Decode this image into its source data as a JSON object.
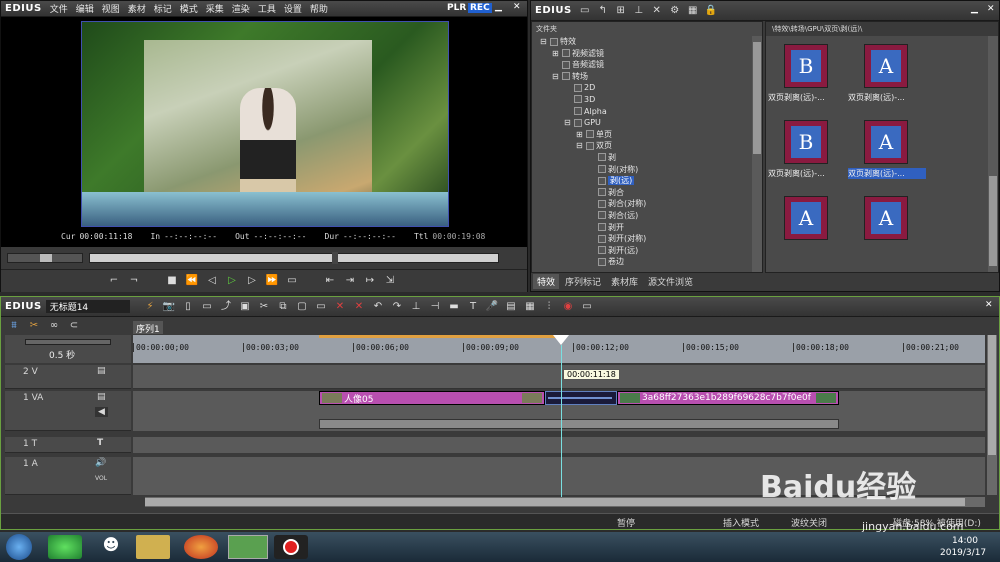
{
  "left_window": {
    "brand": "EDIUS",
    "menu": [
      "文件",
      "编辑",
      "视图",
      "素材",
      "标记",
      "模式",
      "采集",
      "渲染",
      "工具",
      "设置",
      "帮助"
    ],
    "plr": "PLR",
    "rec": "REC"
  },
  "preview": {
    "cur_label": "Cur",
    "cur_value": "00:00:11:18",
    "in_label": "In",
    "in_value": "--:--:--:--",
    "out_label": "Out",
    "out_value": "--:--:--:--",
    "dur_label": "Dur",
    "dur_value": "--:--:--:--",
    "ttl_label": "Ttl",
    "ttl_value": "00:00:19:08"
  },
  "right_window": {
    "brand": "EDIUS",
    "tree_header": "文件夹",
    "path": "\\特效\\转场\\GPU\\双页\\剥(远)\\",
    "tree": [
      {
        "label": "特效",
        "indent": 0,
        "expander": "⊟"
      },
      {
        "label": "视频滤镜",
        "indent": 1,
        "expander": "⊞"
      },
      {
        "label": "音频滤镜",
        "indent": 1,
        "expander": ""
      },
      {
        "label": "转场",
        "indent": 1,
        "expander": "⊟"
      },
      {
        "label": "2D",
        "indent": 2,
        "expander": ""
      },
      {
        "label": "3D",
        "indent": 2,
        "expander": ""
      },
      {
        "label": "Alpha",
        "indent": 2,
        "expander": ""
      },
      {
        "label": "GPU",
        "indent": 2,
        "expander": "⊟"
      },
      {
        "label": "单页",
        "indent": 3,
        "expander": "⊞"
      },
      {
        "label": "双页",
        "indent": 3,
        "expander": "⊟"
      },
      {
        "label": "剥",
        "indent": 4,
        "expander": ""
      },
      {
        "label": "剥(对称)",
        "indent": 4,
        "expander": ""
      },
      {
        "label": "剥(远)",
        "indent": 4,
        "expander": "",
        "selected": true
      },
      {
        "label": "剥合",
        "indent": 4,
        "expander": ""
      },
      {
        "label": "剥合(对称)",
        "indent": 4,
        "expander": ""
      },
      {
        "label": "剥合(远)",
        "indent": 4,
        "expander": ""
      },
      {
        "label": "剥开",
        "indent": 4,
        "expander": ""
      },
      {
        "label": "剥开(对称)",
        "indent": 4,
        "expander": ""
      },
      {
        "label": "剥开(远)",
        "indent": 4,
        "expander": ""
      },
      {
        "label": "卷边",
        "indent": 4,
        "expander": ""
      }
    ],
    "thumbnails": [
      {
        "label": "双页剥离(远)-...",
        "letter": "B"
      },
      {
        "label": "双页剥离(远)-...",
        "letter": "A"
      },
      {
        "label": "双页剥离(远)-...",
        "letter": "B"
      },
      {
        "label": "双页剥离(远)-...",
        "letter": "A",
        "selected": true
      },
      {
        "label": "",
        "letter": "A"
      },
      {
        "label": "",
        "letter": "A"
      }
    ],
    "tabs": [
      "特效",
      "序列标记",
      "素材库",
      "源文件浏览"
    ]
  },
  "timeline": {
    "brand": "EDIUS",
    "project": "无标题14",
    "sequence_tab": "序列1",
    "zoom": "0.5 秒",
    "ruler": [
      "00:00:00;00",
      "00:00:03;00",
      "00:00:06;00",
      "00:00:09;00",
      "00:00:12;00",
      "00:00:15;00",
      "00:00:18;00",
      "00:00:21;00"
    ],
    "playhead_tc": "00:00:11:18",
    "tracks": {
      "v2": "2 V",
      "va1": "1 VA",
      "t1": "1 T",
      "a1": "1 A",
      "vol": "VOL"
    },
    "clip1": "人像05",
    "clip2": "3a68ff27363e1b289f69628c7b7f0e0f"
  },
  "statusbar": {
    "pause": "暂停",
    "insert": "插入模式",
    "ripple": "波纹关闭",
    "disk": "磁盘:58% 被使用(D:)"
  },
  "taskbar": {
    "time": "14:00",
    "date": "2019/3/17"
  },
  "watermark": {
    "logo": "Baidu经验",
    "url": "jingyan.baidu.com"
  },
  "colors": {
    "clip_purple": "#b84fb0",
    "rec_blue": "#2060d0",
    "accent_green": "#6fa040"
  }
}
